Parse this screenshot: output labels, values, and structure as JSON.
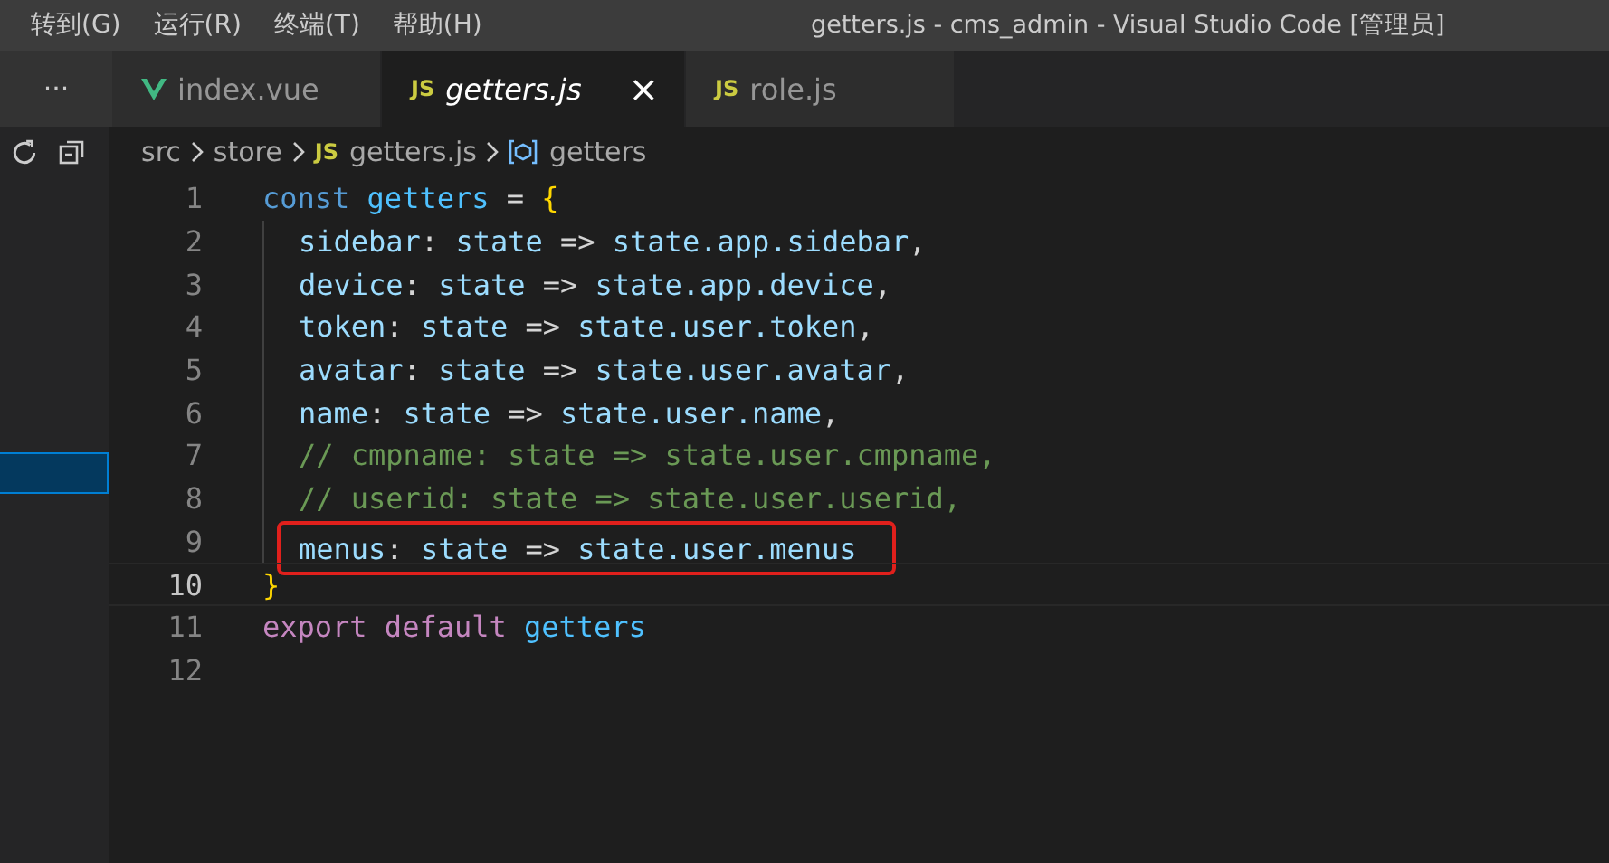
{
  "menu": [
    {
      "label": "转到(G)"
    },
    {
      "label": "运行(R)"
    },
    {
      "label": "终端(T)"
    },
    {
      "label": "帮助(H)"
    }
  ],
  "window": {
    "title": "getters.js - cms_admin - Visual Studio Code [管理员]"
  },
  "side_toolbar": {
    "more": "···"
  },
  "tabs": [
    {
      "label": "index.vue",
      "icon": {
        "kind": "vue"
      },
      "selected": false,
      "preview": false
    },
    {
      "label": "getters.js",
      "icon": {
        "kind": "js",
        "text": "JS"
      },
      "selected": true,
      "preview": true,
      "close": "×"
    },
    {
      "label": "role.js",
      "icon": {
        "kind": "js",
        "text": "JS"
      },
      "selected": false,
      "preview": false
    }
  ],
  "breadcrumb": [
    {
      "text": "src"
    },
    {
      "text": "store"
    },
    {
      "text": "getters.js",
      "icon": {
        "kind": "js",
        "text": "JS"
      }
    },
    {
      "text": "getters",
      "icon": {
        "kind": "symbol"
      }
    }
  ],
  "explorer": {
    "rows": [
      {
        "selected": true
      }
    ]
  },
  "editor": {
    "lines": [
      {
        "number": "1",
        "current": false,
        "guide": false,
        "boxed": false,
        "tokens": [
          {
            "kind": "keyword",
            "text": "const "
          },
          {
            "kind": "constant",
            "text": "getters"
          },
          {
            "kind": "punct",
            "text": " = "
          },
          {
            "kind": "brace",
            "text": "{"
          }
        ]
      },
      {
        "number": "2",
        "current": false,
        "guide": true,
        "boxed": false,
        "tokens": [
          {
            "kind": "property",
            "text": "sidebar"
          },
          {
            "kind": "punct",
            "text": ": "
          },
          {
            "kind": "property",
            "text": "state"
          },
          {
            "kind": "punct",
            "text": " => "
          },
          {
            "kind": "property",
            "text": "state.app.sidebar"
          },
          {
            "kind": "punct",
            "text": ","
          }
        ]
      },
      {
        "number": "3",
        "current": false,
        "guide": true,
        "boxed": false,
        "tokens": [
          {
            "kind": "property",
            "text": "device"
          },
          {
            "kind": "punct",
            "text": ": "
          },
          {
            "kind": "property",
            "text": "state"
          },
          {
            "kind": "punct",
            "text": " => "
          },
          {
            "kind": "property",
            "text": "state.app.device"
          },
          {
            "kind": "punct",
            "text": ","
          }
        ]
      },
      {
        "number": "4",
        "current": false,
        "guide": true,
        "boxed": false,
        "tokens": [
          {
            "kind": "property",
            "text": "token"
          },
          {
            "kind": "punct",
            "text": ": "
          },
          {
            "kind": "property",
            "text": "state"
          },
          {
            "kind": "punct",
            "text": " => "
          },
          {
            "kind": "property",
            "text": "state.user.token"
          },
          {
            "kind": "punct",
            "text": ","
          }
        ]
      },
      {
        "number": "5",
        "current": false,
        "guide": true,
        "boxed": false,
        "tokens": [
          {
            "kind": "property",
            "text": "avatar"
          },
          {
            "kind": "punct",
            "text": ": "
          },
          {
            "kind": "property",
            "text": "state"
          },
          {
            "kind": "punct",
            "text": " => "
          },
          {
            "kind": "property",
            "text": "state.user.avatar"
          },
          {
            "kind": "punct",
            "text": ","
          }
        ]
      },
      {
        "number": "6",
        "current": false,
        "guide": true,
        "boxed": false,
        "tokens": [
          {
            "kind": "property",
            "text": "name"
          },
          {
            "kind": "punct",
            "text": ": "
          },
          {
            "kind": "property",
            "text": "state"
          },
          {
            "kind": "punct",
            "text": " => "
          },
          {
            "kind": "property",
            "text": "state.user.name"
          },
          {
            "kind": "punct",
            "text": ","
          }
        ]
      },
      {
        "number": "7",
        "current": false,
        "guide": true,
        "boxed": false,
        "tokens": [
          {
            "kind": "comment",
            "text": "// cmpname: state => state.user.cmpname,"
          }
        ]
      },
      {
        "number": "8",
        "current": false,
        "guide": true,
        "boxed": false,
        "tokens": [
          {
            "kind": "comment",
            "text": "// userid: state => state.user.userid,"
          }
        ]
      },
      {
        "number": "9",
        "current": false,
        "guide": true,
        "boxed": true,
        "tokens": [
          {
            "kind": "property",
            "text": "menus"
          },
          {
            "kind": "punct",
            "text": ": "
          },
          {
            "kind": "property",
            "text": "state"
          },
          {
            "kind": "punct",
            "text": " => "
          },
          {
            "kind": "property",
            "text": "state.user.menus"
          }
        ]
      },
      {
        "number": "10",
        "current": true,
        "guide": false,
        "boxed": false,
        "tokens": [
          {
            "kind": "brace",
            "text": "}"
          }
        ]
      },
      {
        "number": "11",
        "current": false,
        "guide": false,
        "boxed": false,
        "tokens": [
          {
            "kind": "control",
            "text": "export default "
          },
          {
            "kind": "constant",
            "text": "getters"
          }
        ]
      },
      {
        "number": "12",
        "current": false,
        "guide": false,
        "boxed": false
      }
    ]
  }
}
